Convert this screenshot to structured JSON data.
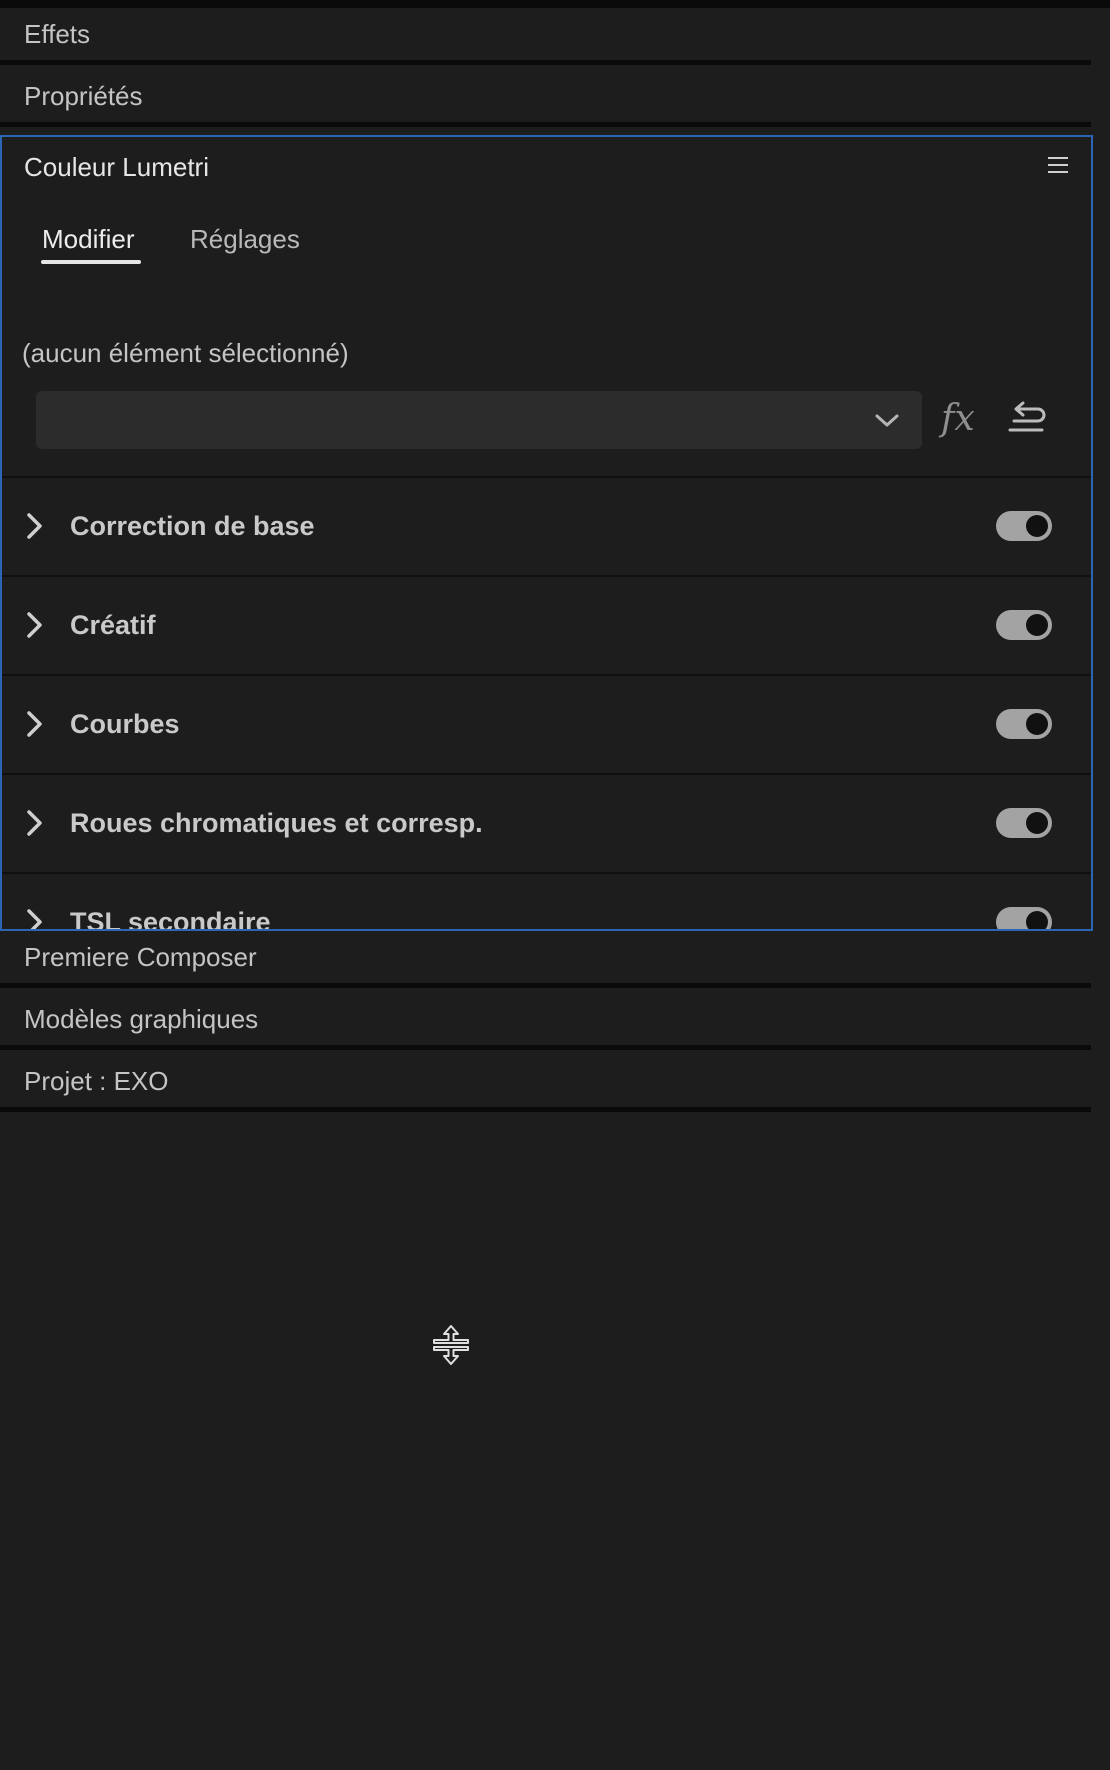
{
  "panels": {
    "effets": "Effets",
    "proprietes": "Propriétés",
    "premiere_composer": "Premiere Composer",
    "modeles_graphiques": "Modèles graphiques",
    "projet": "Projet : EXO"
  },
  "lumetri": {
    "title": "Couleur Lumetri",
    "menu_icon": "hamburger-menu-icon",
    "tabs": [
      {
        "label": "Modifier",
        "active": true
      },
      {
        "label": "Réglages",
        "active": false
      }
    ],
    "selection_text": "(aucun élément sélectionné)",
    "dropdown_value": "",
    "fx_label": "fx",
    "sections": [
      {
        "label": "Correction de base",
        "enabled": true
      },
      {
        "label": "Créatif",
        "enabled": true
      },
      {
        "label": "Courbes",
        "enabled": true
      },
      {
        "label": "Roues chromatiques et corresp.",
        "enabled": true
      },
      {
        "label": "TSL secondaire",
        "enabled": true
      }
    ]
  },
  "colors": {
    "background": "#1d1d1d",
    "accent_border": "#2c65b4",
    "toggle_on": "#a3a3a3"
  }
}
